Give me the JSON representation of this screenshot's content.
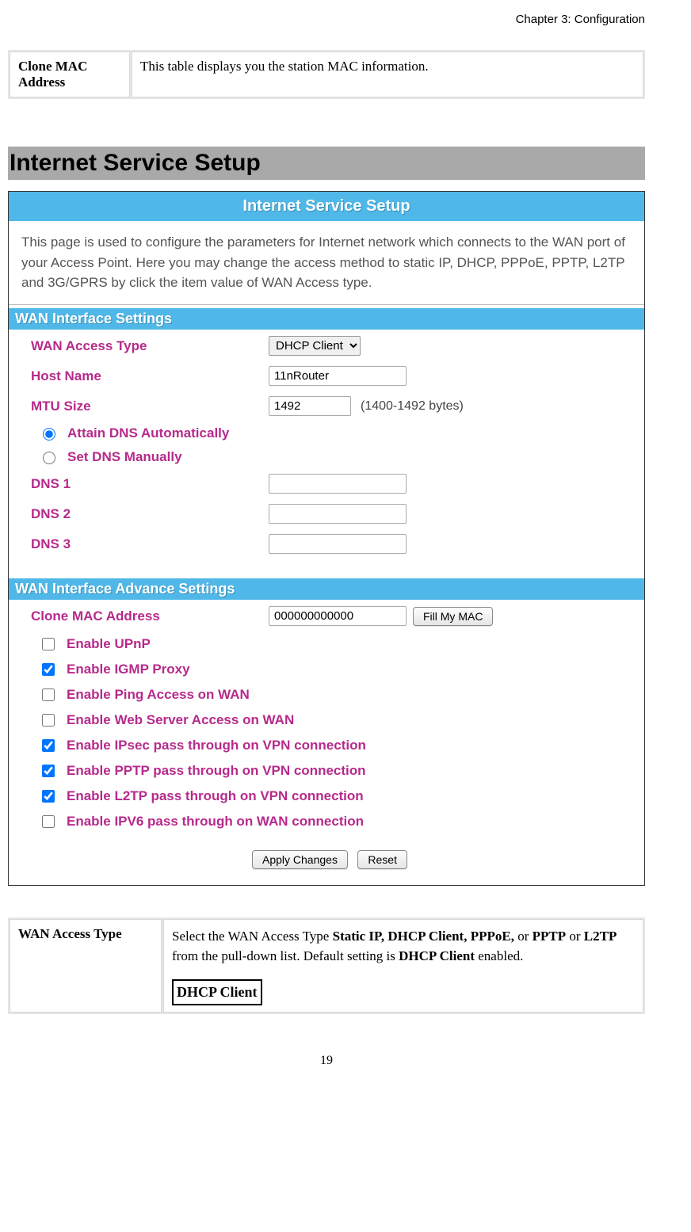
{
  "header": {
    "chapter": "Chapter 3: Configuration"
  },
  "top_table": {
    "label": "Clone MAC Address",
    "desc": "This table displays you the station MAC information."
  },
  "section_heading": "Internet Service Setup",
  "screenshot": {
    "title": "Internet Service Setup",
    "description": "This page is used to configure the parameters for Internet network which connects to the WAN port of your Access Point. Here you may change the access method to static IP, DHCP, PPPoE, PPTP, L2TP and 3G/GPRS by click the item value of WAN Access type.",
    "wan_section": "WAN Interface Settings",
    "fields": {
      "wan_access_type_label": "WAN Access Type",
      "wan_access_type_value": "DHCP Client",
      "host_name_label": "Host Name",
      "host_name_value": "11nRouter",
      "mtu_size_label": "MTU Size",
      "mtu_size_value": "1492",
      "mtu_hint": "(1400-1492 bytes)",
      "dns_auto": "Attain DNS Automatically",
      "dns_manual": "Set DNS Manually",
      "dns1_label": "DNS 1",
      "dns2_label": "DNS 2",
      "dns3_label": "DNS 3"
    },
    "advance_section": "WAN Interface Advance Settings",
    "advance": {
      "clone_mac_label": "Clone MAC Address",
      "clone_mac_value": "000000000000",
      "fill_my_mac": "Fill My MAC",
      "upnp": "Enable UPnP",
      "igmp": "Enable IGMP Proxy",
      "ping": "Enable Ping Access on WAN",
      "webserver": "Enable Web Server Access on WAN",
      "ipsec": "Enable IPsec pass through on VPN connection",
      "pptp": "Enable PPTP pass through on VPN connection",
      "l2tp": "Enable L2TP pass through on VPN connection",
      "ipv6": "Enable IPV6 pass through on WAN connection"
    },
    "buttons": {
      "apply": "Apply Changes",
      "reset": "Reset"
    }
  },
  "bottom_table": {
    "label": "WAN Access Type",
    "desc_part1": "Select the WAN Access Type ",
    "desc_bold1": "Static IP, DHCP Client, PPPoE,",
    "desc_part2": " or ",
    "desc_bold2": "PPTP",
    "desc_part3": " or ",
    "desc_bold3": "L2TP",
    "desc_part4": " from the pull-down list. Default setting is ",
    "desc_bold4": "DHCP Client",
    "desc_part5": " enabled.",
    "boxed": "DHCP Client"
  },
  "page_number": "19"
}
